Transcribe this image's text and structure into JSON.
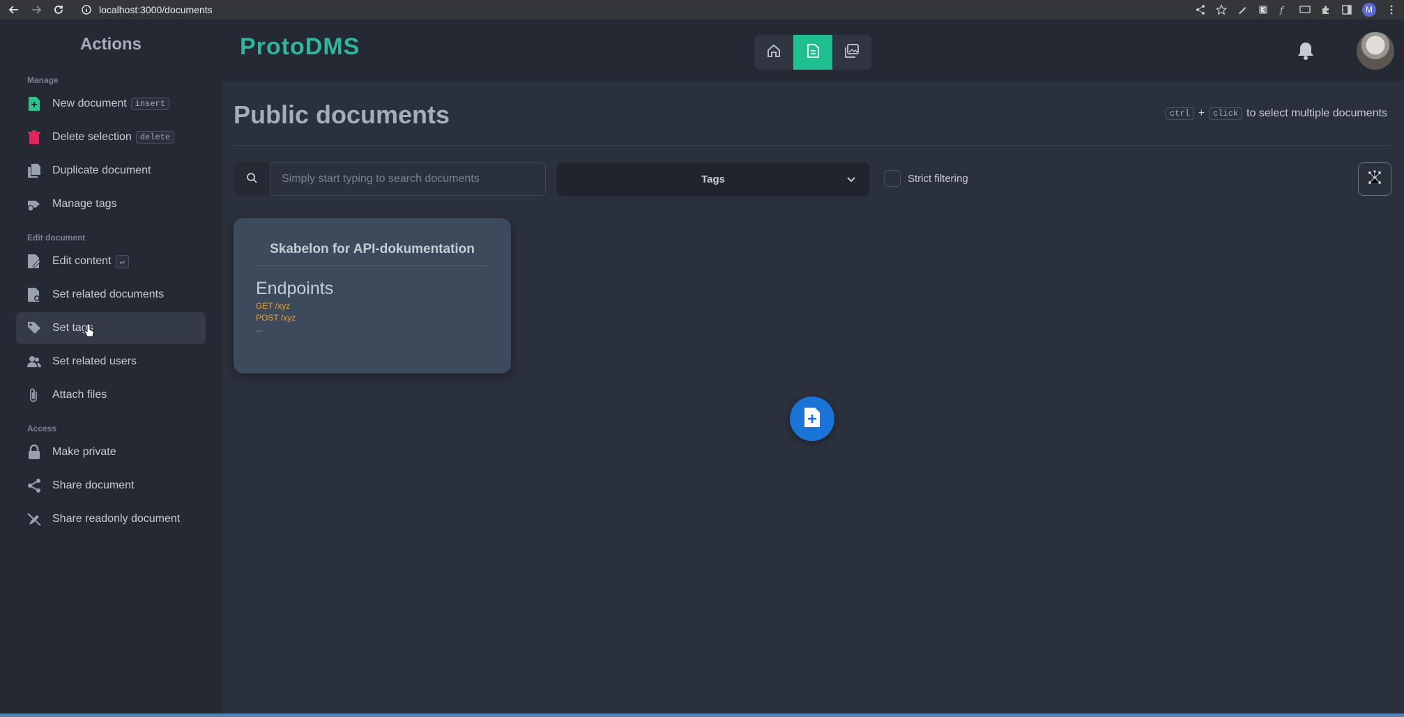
{
  "browser": {
    "url": "localhost:3000/documents",
    "profile_initial": "M"
  },
  "sidebar": {
    "title": "Actions",
    "sections": {
      "manage": "Manage",
      "edit": "Edit document",
      "access": "Access"
    },
    "items": {
      "new_document": {
        "label": "New document",
        "shortcut": "insert"
      },
      "delete_selection": {
        "label": "Delete selection",
        "shortcut": "delete"
      },
      "duplicate": {
        "label": "Duplicate document"
      },
      "manage_tags": {
        "label": "Manage tags"
      },
      "edit_content": {
        "label": "Edit content",
        "shortcut": "↵"
      },
      "set_related_documents": {
        "label": "Set related documents"
      },
      "set_tags": {
        "label": "Set tags"
      },
      "set_related_users": {
        "label": "Set related users"
      },
      "attach_files": {
        "label": "Attach files"
      },
      "make_private": {
        "label": "Make private"
      },
      "share_document": {
        "label": "Share document"
      },
      "share_readonly": {
        "label": "Share readonly document"
      }
    }
  },
  "header": {
    "logo": "ProtoDMS"
  },
  "main": {
    "title": "Public documents",
    "hint": {
      "key1": "ctrl",
      "plus": "+",
      "key2": "click",
      "text": "to select multiple documents"
    },
    "search": {
      "placeholder": "Simply start typing to search documents",
      "value": ""
    },
    "tags_select": {
      "label": "Tags"
    },
    "strict_filtering": {
      "label": "Strict filtering",
      "checked": false
    },
    "documents": [
      {
        "title": "Skabelon for API-dokumentation",
        "heading": "Endpoints",
        "lines": [
          "GET /xyz",
          "POST /xyz"
        ],
        "ellipsis": "..."
      }
    ]
  },
  "colors": {
    "accent": "#1fbf8f",
    "logo": "#2fb59a",
    "fab": "#1a73d6",
    "delete_icon": "#e0245e",
    "new_icon": "#2bc48a"
  }
}
